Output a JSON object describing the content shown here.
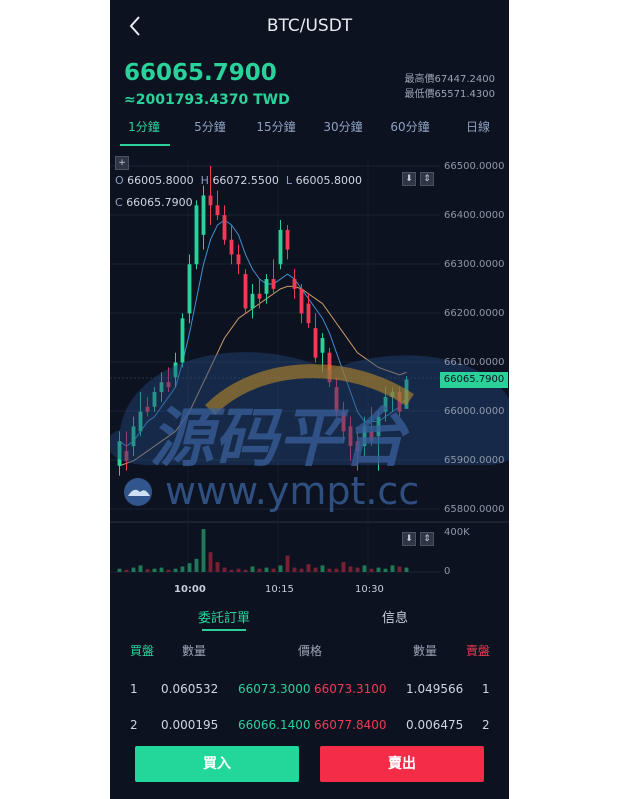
{
  "header": {
    "title": "BTC/USDT",
    "back_icon": "chevron-left-icon"
  },
  "ticker": {
    "last_price": "66065.7900",
    "twd_price": "≈2001793.4370 TWD",
    "high_label": "最高價67447.2400",
    "low_label": "最低價65571.4300"
  },
  "intervals": [
    "1分鐘",
    "5分鐘",
    "15分鐘",
    "30分鐘",
    "60分鐘",
    "日線"
  ],
  "active_interval": "1分鐘",
  "ohlc": {
    "o_label": "O",
    "o_value": "66005.8000",
    "h_label": "H",
    "h_value": "66072.5500",
    "l_label": "L",
    "l_value": "66005.8000",
    "c_label": "C",
    "c_value": "66065.7900"
  },
  "price_axis": [
    "66500.0000",
    "66400.0000",
    "66300.0000",
    "66200.0000",
    "66100.0000",
    "66000.0000",
    "65900.0000",
    "65800.0000"
  ],
  "current_price_tag": "66065.7900",
  "volume_axis": [
    "400K",
    "0"
  ],
  "time_axis": [
    "10:00",
    "10:15",
    "10:30"
  ],
  "watermark": {
    "text_cn": "源码平台",
    "text_url": "www.ympt.cc"
  },
  "colors": {
    "up": "#2ad29a",
    "down": "#f23a54",
    "bg": "#0c1220",
    "ma1": "#3f8fd0",
    "ma2": "#c99a6a"
  },
  "chart_data": {
    "type": "candlestick",
    "ylim": [
      65800,
      66500
    ],
    "candles": [
      {
        "o": 65890,
        "h": 65960,
        "l": 65870,
        "c": 65940
      },
      {
        "o": 65920,
        "h": 65960,
        "l": 65880,
        "c": 65900
      },
      {
        "o": 65930,
        "h": 65990,
        "l": 65910,
        "c": 65970
      },
      {
        "o": 65960,
        "h": 66040,
        "l": 65950,
        "c": 66000
      },
      {
        "o": 66010,
        "h": 66030,
        "l": 65990,
        "c": 66000
      },
      {
        "o": 66010,
        "h": 66050,
        "l": 66000,
        "c": 66040
      },
      {
        "o": 66040,
        "h": 66080,
        "l": 66020,
        "c": 66060
      },
      {
        "o": 66060,
        "h": 66090,
        "l": 66040,
        "c": 66050
      },
      {
        "o": 66070,
        "h": 66120,
        "l": 66050,
        "c": 66100
      },
      {
        "o": 66100,
        "h": 66200,
        "l": 66090,
        "c": 66190
      },
      {
        "o": 66200,
        "h": 66320,
        "l": 66180,
        "c": 66300
      },
      {
        "o": 66300,
        "h": 66430,
        "l": 66290,
        "c": 66420
      },
      {
        "o": 66360,
        "h": 66460,
        "l": 66330,
        "c": 66440
      },
      {
        "o": 66440,
        "h": 66500,
        "l": 66380,
        "c": 66420
      },
      {
        "o": 66420,
        "h": 66450,
        "l": 66390,
        "c": 66400
      },
      {
        "o": 66400,
        "h": 66420,
        "l": 66340,
        "c": 66350
      },
      {
        "o": 66350,
        "h": 66380,
        "l": 66300,
        "c": 66320
      },
      {
        "o": 66320,
        "h": 66340,
        "l": 66280,
        "c": 66300
      },
      {
        "o": 66280,
        "h": 66290,
        "l": 66200,
        "c": 66210
      },
      {
        "o": 66210,
        "h": 66260,
        "l": 66190,
        "c": 66240
      },
      {
        "o": 66240,
        "h": 66270,
        "l": 66210,
        "c": 66230
      },
      {
        "o": 66240,
        "h": 66280,
        "l": 66220,
        "c": 66270
      },
      {
        "o": 66270,
        "h": 66310,
        "l": 66240,
        "c": 66250
      },
      {
        "o": 66300,
        "h": 66390,
        "l": 66290,
        "c": 66370
      },
      {
        "o": 66370,
        "h": 66380,
        "l": 66310,
        "c": 66330
      },
      {
        "o": 66270,
        "h": 66290,
        "l": 66230,
        "c": 66250
      },
      {
        "o": 66250,
        "h": 66260,
        "l": 66180,
        "c": 66200
      },
      {
        "o": 66220,
        "h": 66240,
        "l": 66170,
        "c": 66180
      },
      {
        "o": 66170,
        "h": 66200,
        "l": 66100,
        "c": 66110
      },
      {
        "o": 66120,
        "h": 66160,
        "l": 66080,
        "c": 66150
      },
      {
        "o": 66120,
        "h": 66130,
        "l": 66050,
        "c": 66060
      },
      {
        "o": 66050,
        "h": 66070,
        "l": 65990,
        "c": 66000
      },
      {
        "o": 66000,
        "h": 66020,
        "l": 65940,
        "c": 65960
      },
      {
        "o": 65970,
        "h": 65990,
        "l": 65900,
        "c": 65930
      },
      {
        "o": 65940,
        "h": 65960,
        "l": 65880,
        "c": 65920
      },
      {
        "o": 65930,
        "h": 65990,
        "l": 65910,
        "c": 65970
      },
      {
        "o": 65960,
        "h": 66010,
        "l": 65930,
        "c": 65940
      },
      {
        "o": 65950,
        "h": 66000,
        "l": 65880,
        "c": 65990
      },
      {
        "o": 66000,
        "h": 66050,
        "l": 65980,
        "c": 66030
      },
      {
        "o": 66030,
        "h": 66050,
        "l": 66000,
        "c": 66040
      },
      {
        "o": 66040,
        "h": 66050,
        "l": 65990,
        "c": 66000
      },
      {
        "o": 66005.8,
        "h": 66072.55,
        "l": 66005.8,
        "c": 66065.79
      }
    ],
    "volumes": [
      30,
      20,
      40,
      60,
      25,
      30,
      40,
      20,
      30,
      50,
      80,
      120,
      390,
      180,
      90,
      40,
      20,
      30,
      20,
      50,
      30,
      40,
      30,
      60,
      150,
      40,
      30,
      70,
      40,
      60,
      30,
      30,
      90,
      50,
      40,
      60,
      30,
      40,
      30,
      60,
      50,
      40
    ],
    "ma1": [
      65940,
      65930,
      65940,
      65960,
      65980,
      65990,
      66010,
      66030,
      66050,
      66100,
      66160,
      66230,
      66300,
      66350,
      66380,
      66390,
      66380,
      66360,
      66320,
      66290,
      66270,
      66260,
      66260,
      66270,
      66280,
      66270,
      66250,
      66230,
      66210,
      66190,
      66160,
      66120,
      66080,
      66040,
      66000,
      65980,
      65980,
      65980,
      65990,
      66000,
      66010,
      66030
    ],
    "ma2": [
      65890,
      65895,
      65900,
      65910,
      65920,
      65930,
      65940,
      65950,
      65960,
      65980,
      66000,
      66030,
      66060,
      66090,
      66120,
      66150,
      66170,
      66190,
      66200,
      66210,
      66220,
      66230,
      66240,
      66250,
      66255,
      66255,
      66250,
      66240,
      66230,
      66220,
      66200,
      66180,
      66160,
      66140,
      66120,
      66110,
      66100,
      66090,
      66085,
      66080,
      66075,
      66080
    ]
  },
  "order_book": {
    "tabs": [
      "委託訂單",
      "信息"
    ],
    "active_tab": "委託訂單",
    "header": {
      "buy": "買盤",
      "qty_left": "數量",
      "price": "價格",
      "qty_right": "數量",
      "sell": "賣盤"
    },
    "rows": [
      {
        "idx_left": "1",
        "bid_qty": "0.060532",
        "bid_price": "66073.3000",
        "ask_price": "66073.3100",
        "ask_qty": "1.049566",
        "idx_right": "1"
      },
      {
        "idx_left": "2",
        "bid_qty": "0.000195",
        "bid_price": "66066.1400",
        "ask_price": "66077.8400",
        "ask_qty": "0.006475",
        "idx_right": "2"
      }
    ]
  },
  "actions": {
    "buy_label": "買入",
    "sell_label": "賣出"
  }
}
